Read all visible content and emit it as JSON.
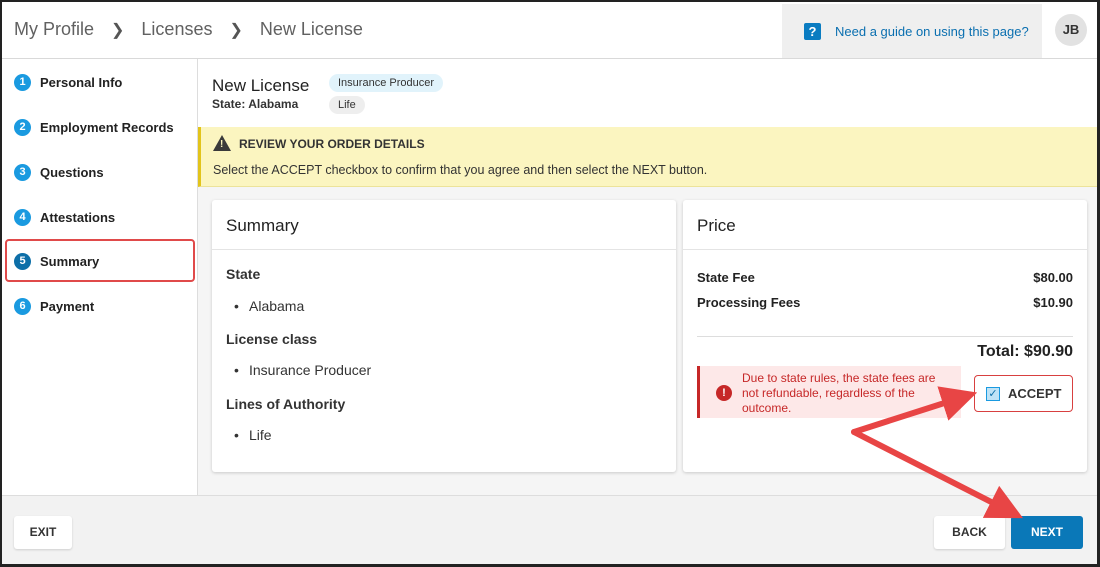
{
  "header": {
    "breadcrumbs": [
      "My Profile",
      "Licenses",
      "New License"
    ],
    "help_text": "Need a guide on using this page?",
    "avatar_initials": "JB"
  },
  "sidebar": {
    "items": [
      {
        "num": "1",
        "label": "Personal Info"
      },
      {
        "num": "2",
        "label": "Employment Records"
      },
      {
        "num": "3",
        "label": "Questions"
      },
      {
        "num": "4",
        "label": "Attestations"
      },
      {
        "num": "5",
        "label": "Summary"
      },
      {
        "num": "6",
        "label": "Payment"
      }
    ],
    "active": "Summary"
  },
  "license": {
    "title": "New License",
    "state_line": "State: Alabama",
    "chips": [
      "Insurance Producer",
      "Life"
    ]
  },
  "warning": {
    "title": "REVIEW YOUR ORDER DETAILS",
    "text": "Select the ACCEPT checkbox to confirm that you agree and then select the NEXT button."
  },
  "summary": {
    "title": "Summary",
    "sections": [
      {
        "label": "State",
        "value": "Alabama"
      },
      {
        "label": "License class",
        "value": "Insurance Producer"
      },
      {
        "label": "Lines of Authority",
        "value": "Life"
      }
    ]
  },
  "price": {
    "title": "Price",
    "rows": [
      {
        "label": "State Fee",
        "amount": "$80.00"
      },
      {
        "label": "Processing Fees",
        "amount": "$10.90"
      }
    ],
    "total": "Total: $90.90",
    "notice": "Due to state rules, the state fees are not refundable, regardless of the outcome.",
    "accept_label": "ACCEPT",
    "accept_checked": true
  },
  "footer": {
    "exit_label": "EXIT",
    "back_label": "BACK",
    "next_label": "NEXT"
  },
  "colors": {
    "primary": "#0a78b8",
    "step_badge": "#1a9ae0",
    "warning_bg": "#fbf5c0",
    "error": "#c62828",
    "annotation": "#e84545"
  }
}
